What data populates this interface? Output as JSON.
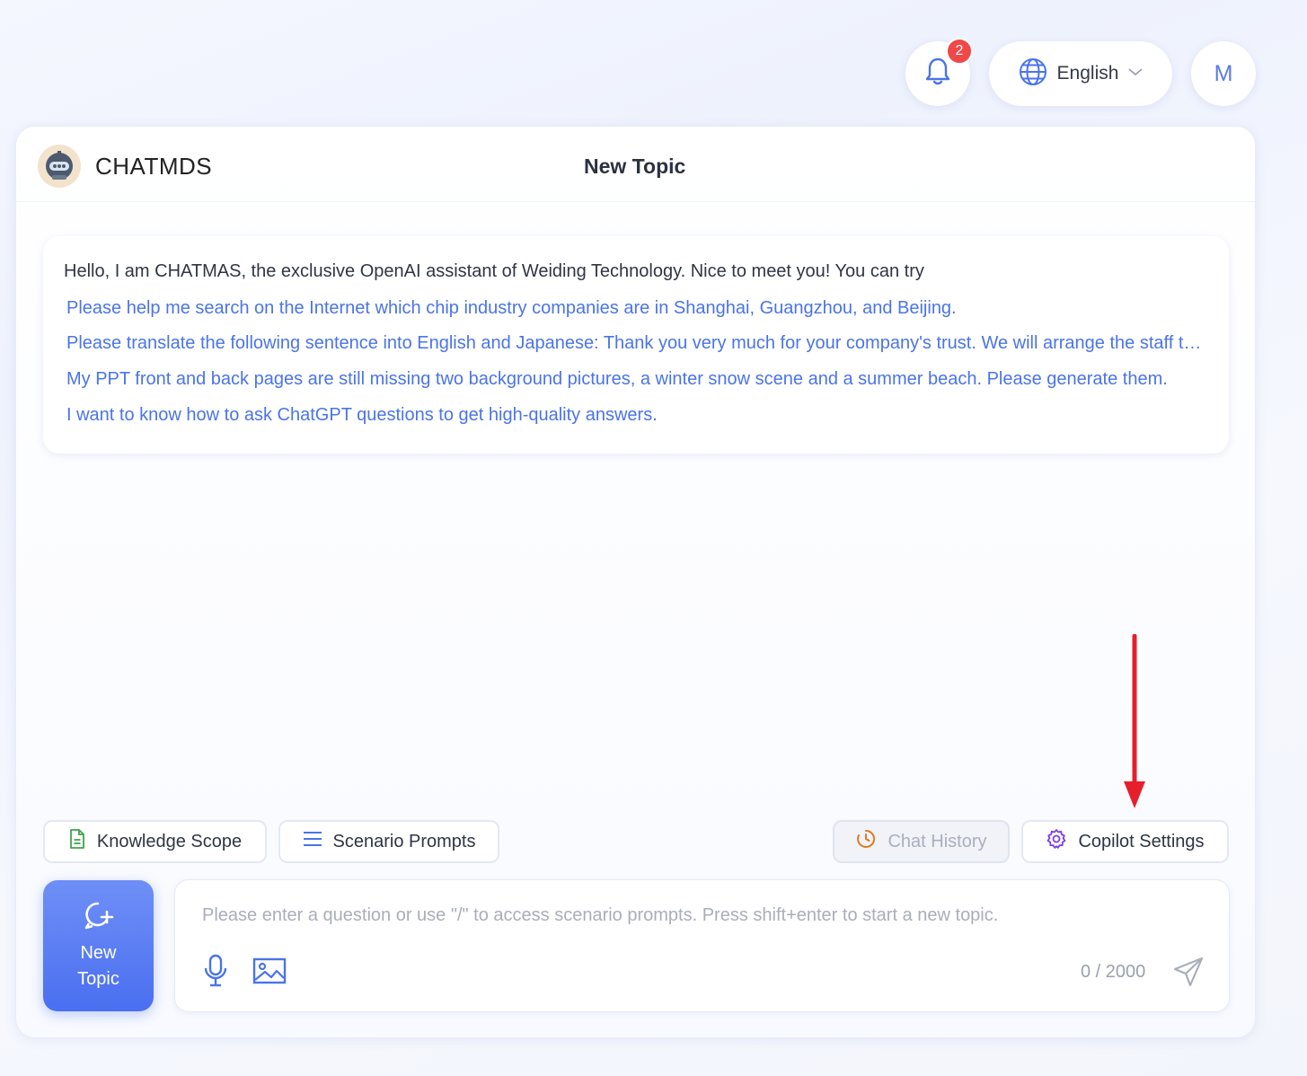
{
  "topbar": {
    "notification_count": "2",
    "language": "English",
    "avatar_initial": "M"
  },
  "header": {
    "brand_name": "CHATMDS",
    "topic_title": "New Topic"
  },
  "welcome": {
    "intro": "Hello, I am CHATMAS, the exclusive OpenAI assistant of Weiding Technology. Nice to meet you! You can try",
    "suggestions": [
      "Please help me search on the Internet which chip industry companies are in Shanghai, Guangzhou, and Beijing.",
      "Please translate the following sentence into English and Japanese: Thank you very much for your company's trust. We will arrange the staff to contact you as soon as possible.",
      "My PPT front and back pages are still missing two background pictures, a winter snow scene and a summer beach. Please generate them.",
      "I want to know how to ask ChatGPT questions to get high-quality answers."
    ]
  },
  "toolbar": {
    "knowledge_scope": "Knowledge Scope",
    "scenario_prompts": "Scenario Prompts",
    "chat_history": "Chat History",
    "copilot_settings": "Copilot Settings"
  },
  "composer": {
    "new_topic_label": "New Topic",
    "placeholder": "Please enter a question or use \"/\" to access scenario prompts. Press shift+enter to start a new topic.",
    "value": "",
    "counter": "0 / 2000"
  },
  "colors": {
    "accent": "#4a74e8",
    "badge": "#f04848",
    "annotation_arrow": "#e5202a"
  }
}
